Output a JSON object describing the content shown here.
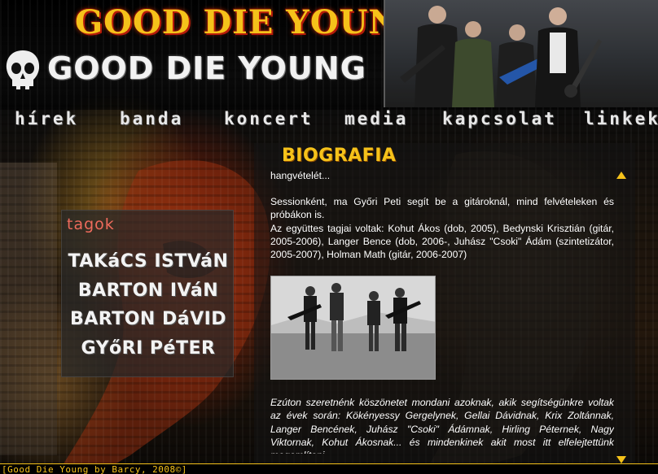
{
  "header": {
    "top_title": "GOOD DIE YOUNG",
    "logo_title": "GOOD DIE YOUNG",
    "logo_icon": "skull-icon"
  },
  "nav": {
    "items": [
      "hírek",
      "banda",
      "koncert",
      "media",
      "kapcsolat",
      "linkek"
    ]
  },
  "tagok": {
    "heading": "tagok",
    "members": [
      "TAKáCS ISTVáN",
      "BARTON IVáN",
      "BARTON DáVID",
      "GYőRI PéTER"
    ]
  },
  "content": {
    "title": "BIOGRAFIA",
    "p1": "hangvételét...",
    "p2": "Sessionként, ma Győri Peti segít be a gitároknál, mind felvételeken és próbákon is.",
    "p3": "Az együttes tagjai voltak: Kohut Ákos (dob, 2005), Bedynski Krisztián (gitár,  2005-2006), Langer Bence (dob, 2006-, Juhász \"Csoki\" Ádám (szintetizátor, 2005-2007), Holman Math (gitár, 2006-2007)",
    "p4": "Ezúton szeretnénk köszönetet mondani azoknak, akik segítségünkre voltak az évek során: Kökényessy Gergelynek, Gellai Dávidnak, Krix Zoltánnak, Langer Bencének, Juhász \"Csoki\" Ádámnak, Hirling Péternek, Nagy Viktornak, Kohut Ákosnak... és mindenkinek akit most itt elfelejtettünk megemlíteni..."
  },
  "footer": {
    "text": "[Good Die Young by Barcy, 2008©]"
  },
  "colors": {
    "accent": "#f5c21a",
    "tagok_heading": "#ef6b5c"
  }
}
